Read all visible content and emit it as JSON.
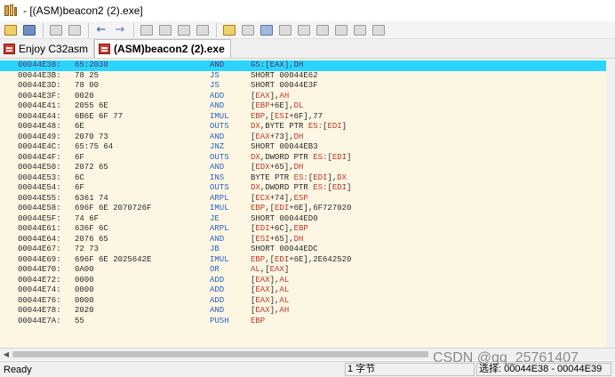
{
  "window": {
    "title": "- [(ASM)beacon2 (2).exe]"
  },
  "toolbar": {
    "icons": [
      "open-icon",
      "save-icon",
      "copy-icon",
      "paste-icon",
      "back-arrow-icon",
      "forward-arrow-icon",
      "tool-a-icon",
      "tool-b-icon",
      "tool-c-icon",
      "tool-d-icon",
      "book-icon",
      "list-icon",
      "align-icon",
      "grid-a-icon",
      "grid-b-icon",
      "grid-c-icon",
      "settings-icon",
      "window-icon",
      "layout-icon"
    ]
  },
  "tabs": [
    {
      "label": "Enjoy C32asm",
      "active": false
    },
    {
      "label": "(ASM)beacon2 (2).exe",
      "active": true
    }
  ],
  "disasm": {
    "rows": [
      {
        "addr": "00044E38:",
        "hex": "65:2030",
        "mn": "AND",
        "op": "GS:[EAX],DH",
        "selected": true
      },
      {
        "addr": "00044E3B:",
        "hex": "78 25",
        "mn": "JS",
        "op": "SHORT 00044E62"
      },
      {
        "addr": "00044E3D:",
        "hex": "78 00",
        "mn": "JS",
        "op": "SHORT 00044E3F"
      },
      {
        "addr": "00044E3F:",
        "hex": "0020",
        "mn": "ADD",
        "op": "[EAX],AH"
      },
      {
        "addr": "00044E41:",
        "hex": "2055 6E",
        "mn": "AND",
        "op": "[EBP+6E],DL"
      },
      {
        "addr": "00044E44:",
        "hex": "6B6E 6F 77",
        "mn": "IMUL",
        "op": "EBP,[ESI+6F],77"
      },
      {
        "addr": "00044E48:",
        "hex": "6E",
        "mn": "OUTS",
        "op": "DX,BYTE PTR ES:[EDI]"
      },
      {
        "addr": "00044E49:",
        "hex": "2070 73",
        "mn": "AND",
        "op": "[EAX+73],DH"
      },
      {
        "addr": "00044E4C:",
        "hex": "65:75 64",
        "mn": "JNZ",
        "op": "SHORT 00044EB3"
      },
      {
        "addr": "00044E4F:",
        "hex": "6F",
        "mn": "OUTS",
        "op": "DX,DWORD PTR ES:[EDI]"
      },
      {
        "addr": "00044E50:",
        "hex": "2072 65",
        "mn": "AND",
        "op": "[EDX+65],DH"
      },
      {
        "addr": "00044E53:",
        "hex": "6C",
        "mn": "INS",
        "op": "BYTE PTR ES:[EDI],DX"
      },
      {
        "addr": "00044E54:",
        "hex": "6F",
        "mn": "OUTS",
        "op": "DX,DWORD PTR ES:[EDI]"
      },
      {
        "addr": "00044E55:",
        "hex": "6361 74",
        "mn": "ARPL",
        "op": "[ECX+74],ESP"
      },
      {
        "addr": "00044E58:",
        "hex": "696F 6E 2070726F",
        "mn": "IMUL",
        "op": "EBP,[EDI+6E],6F727020"
      },
      {
        "addr": "00044E5F:",
        "hex": "74 6F",
        "mn": "JE",
        "op": "SHORT 00044ED0"
      },
      {
        "addr": "00044E61:",
        "hex": "636F 6C",
        "mn": "ARPL",
        "op": "[EDI+6C],EBP"
      },
      {
        "addr": "00044E64:",
        "hex": "2076 65",
        "mn": "AND",
        "op": "[ESI+65],DH"
      },
      {
        "addr": "00044E67:",
        "hex": "72 73",
        "mn": "JB",
        "op": "SHORT 00044EDC"
      },
      {
        "addr": "00044E69:",
        "hex": "696F 6E 2025642E",
        "mn": "IMUL",
        "op": "EBP,[EDI+6E],2E642520"
      },
      {
        "addr": "00044E70:",
        "hex": "0A00",
        "mn": "OR",
        "op": "AL,[EAX]"
      },
      {
        "addr": "00044E72:",
        "hex": "0000",
        "mn": "ADD",
        "op": "[EAX],AL"
      },
      {
        "addr": "00044E74:",
        "hex": "0000",
        "mn": "ADD",
        "op": "[EAX],AL"
      },
      {
        "addr": "00044E76:",
        "hex": "0000",
        "mn": "ADD",
        "op": "[EAX],AL"
      },
      {
        "addr": "00044E78:",
        "hex": "2020",
        "mn": "AND",
        "op": "[EAX],AH"
      },
      {
        "addr": "00044E7A:",
        "hex": "55",
        "mn": "PUSH",
        "op": "EBP"
      }
    ]
  },
  "status": {
    "ready": "Ready",
    "bytes": "1 字节",
    "selection": "选择: 00044E38 - 00044E39"
  },
  "watermark": "CSDN @qq_25761407",
  "colors": {
    "selection": "#2ad6ff",
    "editor_bg": "#fdf6e3",
    "mnemonic": "#2a62c9",
    "register": "#c0392b"
  }
}
